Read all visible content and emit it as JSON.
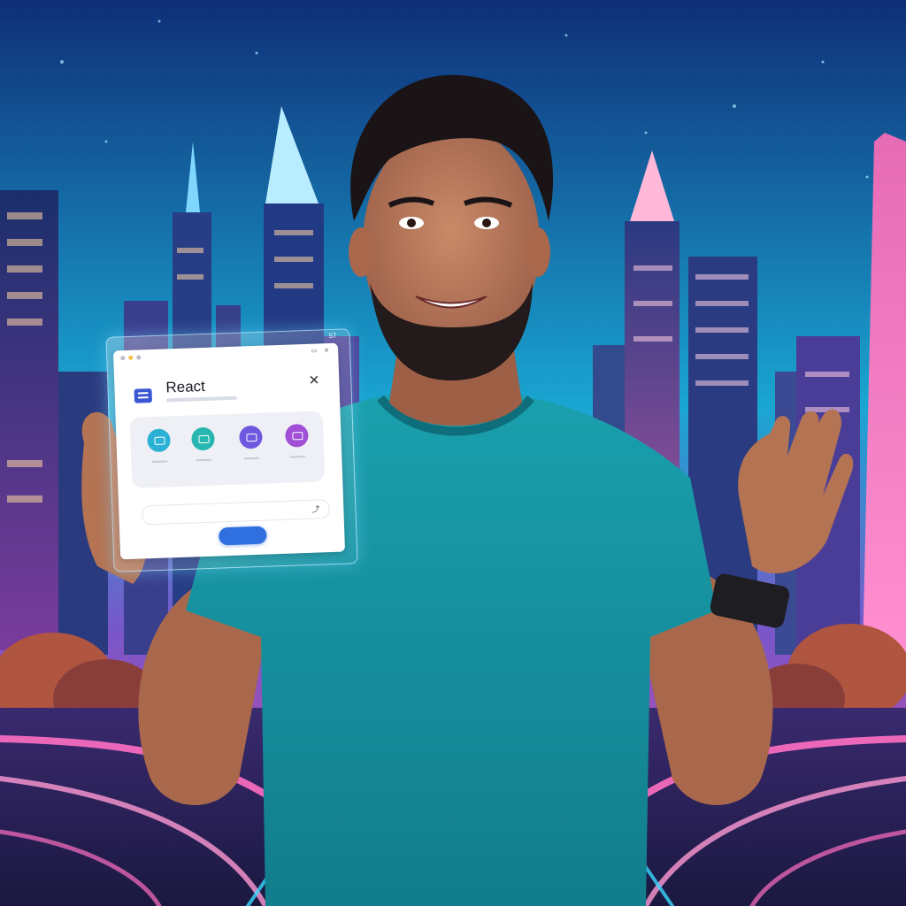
{
  "card": {
    "status_text": "57",
    "title": "React",
    "subtitle": "",
    "tiles": [
      {
        "label": "",
        "color": "#2bb0d6"
      },
      {
        "label": "",
        "color": "#27b7b0"
      },
      {
        "label": "",
        "color": "#6e58e0"
      },
      {
        "label": "",
        "color": "#a04fd6"
      }
    ],
    "search_left": "",
    "search_right": "",
    "button_label": ""
  },
  "scene": {
    "sky_top": "#123b8c",
    "sky_bottom": "#1fb6d9",
    "neon_pink": "#ff4fb0",
    "neon_cyan": "#38d8ff",
    "shirt": "#18909e",
    "skin": "#b9785a",
    "hair": "#1a1417"
  }
}
